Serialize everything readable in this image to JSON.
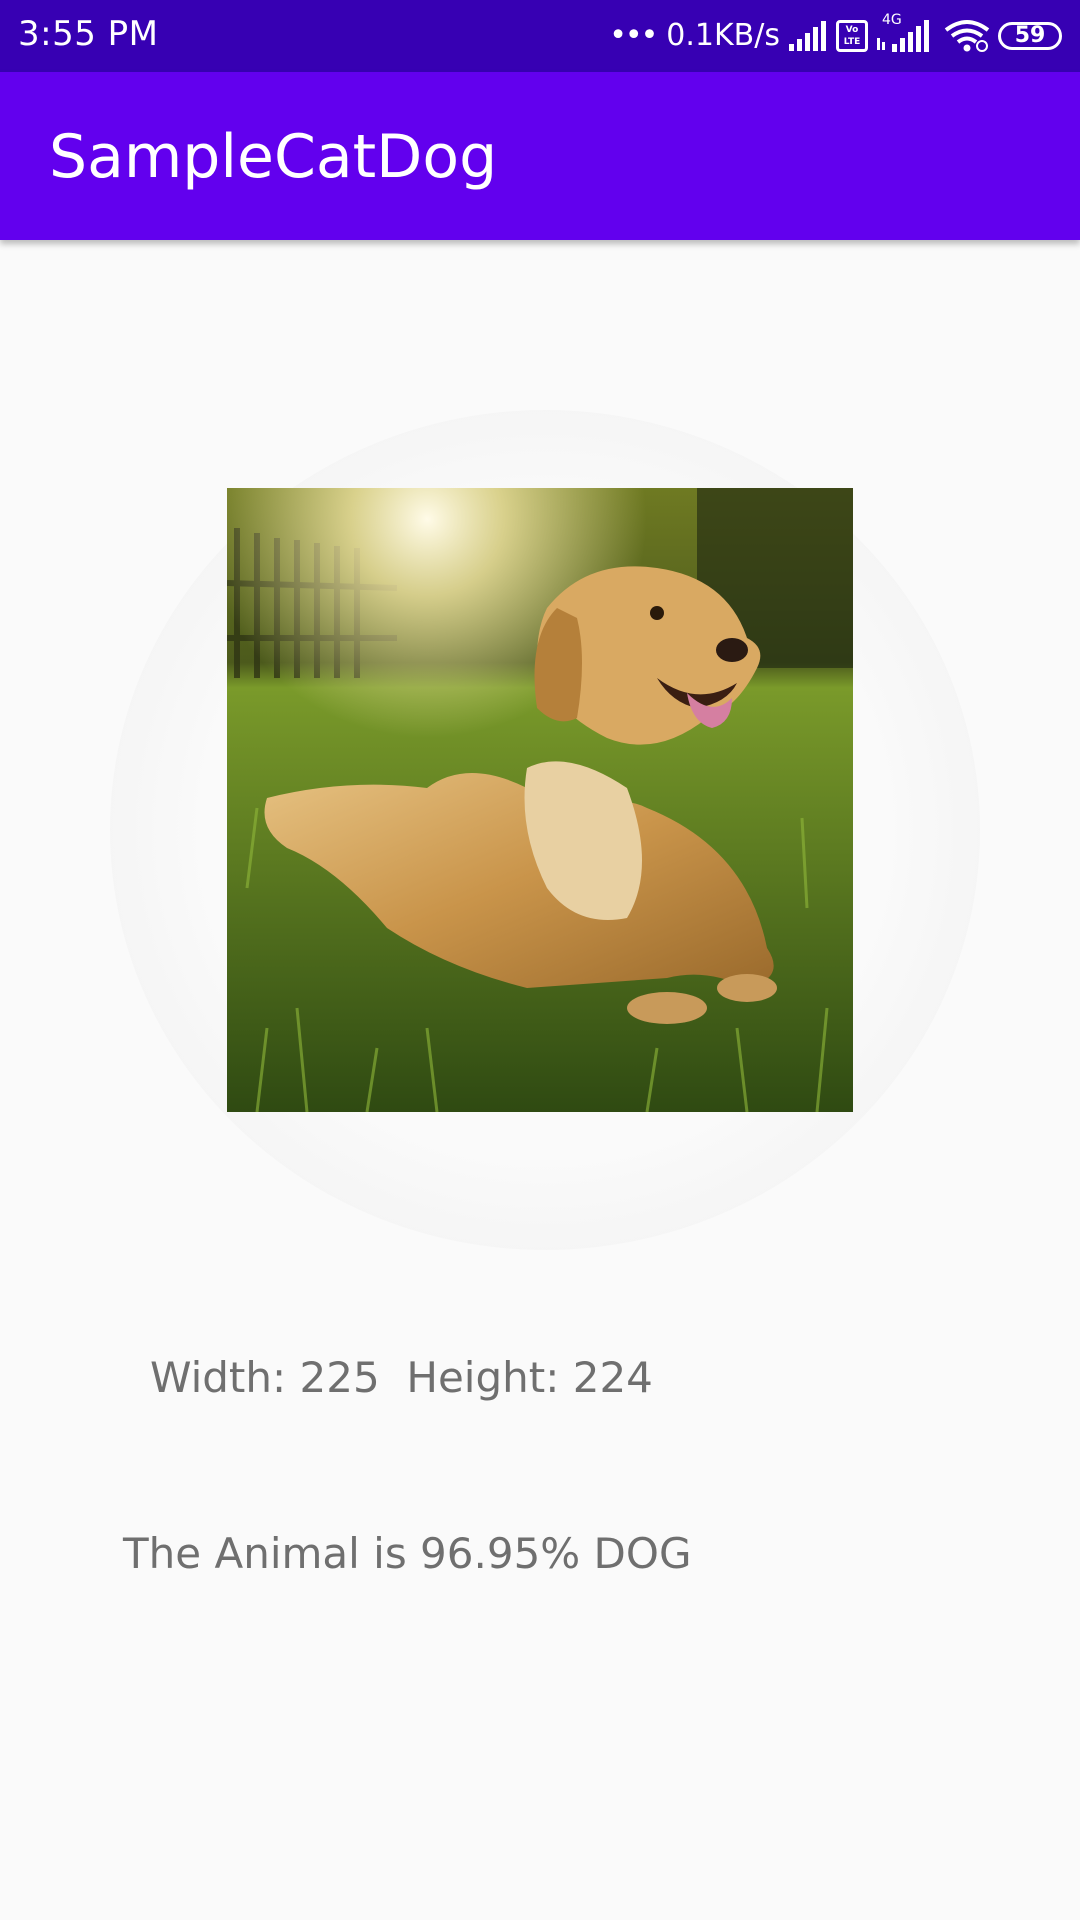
{
  "status_bar": {
    "time": "3:55 PM",
    "network_speed": "0.1KB/s",
    "volte_label": "Vo LTE",
    "network_type": "4G",
    "battery": "59",
    "color": "#3700b3"
  },
  "app_bar": {
    "title": "SampleCatDog",
    "color": "#6200ee"
  },
  "image": {
    "subject": "golden retriever lying on grass"
  },
  "result": {
    "dimensions_text": "Width: 225  Height: 224",
    "prediction_text": "The Animal is 96.95% DOG"
  }
}
